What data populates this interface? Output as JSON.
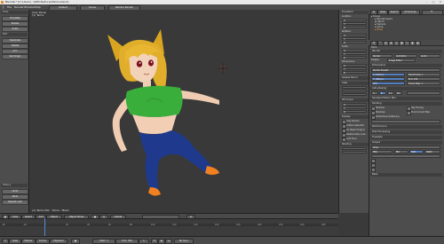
{
  "window": {
    "title": "Blender* [C:\\Users\\...\\WithTextures\\Tama.blend]"
  },
  "menu": {
    "items": [
      "File",
      "Render",
      "Window",
      "Help"
    ],
    "layout": "Default",
    "scene": "Scene",
    "engine": "Blender Render"
  },
  "toolshelf": {
    "tab_header": "Tools",
    "buttons": [
      "Translate",
      "Rotate",
      "Scale",
      "Duplicate",
      "Delete",
      "Join",
      "Set Origin"
    ],
    "sections": [
      "Edit",
      "History"
    ],
    "bottom_buttons": [
      "Undo",
      "Redo",
      "Repeat Last"
    ]
  },
  "viewport": {
    "label_line1": "User Persp",
    "label_line2": "(1) Tama",
    "status": "(1) Tama.001 : Tama : Mesh"
  },
  "viewport_header": {
    "items": [
      "View",
      "Select",
      "Add",
      "Object",
      "Object Mode",
      "Global"
    ]
  },
  "npanel": {
    "sections": [
      "Transform",
      "Location:",
      "Rotation:",
      "Scale:",
      "Dimensions:",
      "Grease Pencil",
      "View",
      "3D Cursor",
      "Display",
      "Shading"
    ],
    "fields": [
      "X:",
      "Y:",
      "Z:"
    ],
    "checks": [
      "Only Render",
      "Outline Selected",
      "All Object Origins",
      "Relationship Lines",
      "Grid Floor"
    ]
  },
  "outliner": {
    "rows": [
      "Scene",
      "RenderLayers",
      "World",
      "Camera",
      "Lamp",
      "Tama"
    ],
    "header": [
      "View",
      "Search",
      "All Scenes"
    ]
  },
  "properties": {
    "breadcrumb": "Tama",
    "panels": [
      "Render",
      "Dimensions",
      "Anti-Aliasing",
      "Sampled Motion Blur",
      "Shading",
      "Performance",
      "Post Processing",
      "Freestyle",
      "Output",
      "Bake"
    ],
    "render_buttons": [
      "Render",
      "Animation",
      "Audio"
    ],
    "display_label": "Display:",
    "display_value": "Image Editor",
    "preset_label": "Render Presets",
    "resolution": [
      "X: 1920 px",
      "Y: 1080 px",
      "50%"
    ],
    "frame_range": [
      "Start Frame: 1",
      "End: 250",
      "Frame Step: 1"
    ],
    "aa_values": [
      "5",
      "8",
      "11",
      "16"
    ],
    "checks": [
      "Textures",
      "Shadows",
      "Ray Tracing",
      "Subsurface Scattering",
      "Environment Map"
    ],
    "output_path": "/tmp/",
    "format": "PNG",
    "bw": "BW",
    "rgb": "RGB",
    "rgba": "RGBA"
  },
  "timeline": {
    "ticks": [
      "-40",
      "-20",
      "0",
      "20",
      "40",
      "60",
      "80",
      "100",
      "120",
      "140",
      "160",
      "180",
      "200",
      "220",
      "240",
      "260"
    ],
    "header": [
      "View",
      "Marker",
      "Frame",
      "Playback",
      "Start: 1",
      "End: 250",
      "1",
      "No Sync"
    ]
  }
}
